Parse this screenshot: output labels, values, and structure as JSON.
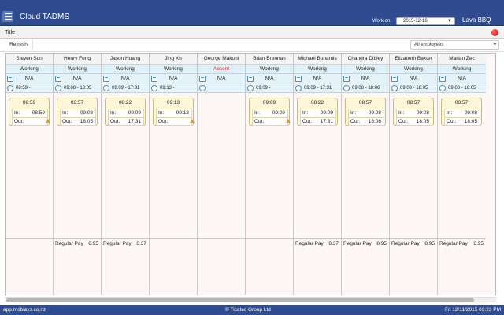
{
  "header": {
    "app_title": "Cloud TADMS",
    "work_on_label": "Work on:",
    "work_on_date": "2015-12-16",
    "company": "Lava BBQ"
  },
  "panel": {
    "title": "Title"
  },
  "toolbar": {
    "refresh_label": "Refresh",
    "employee_filter": "All employees"
  },
  "employees": [
    {
      "name": "Steven Sun",
      "status": "Working",
      "role": "N/A",
      "shift": "08:59 -",
      "card": {
        "time": "08:59",
        "in_label": "In:",
        "in": "08:59",
        "out_label": "Out:",
        "out": ""
      },
      "pay_label": "",
      "pay": ""
    },
    {
      "name": "Henry Feng",
      "status": "Working",
      "role": "N/A",
      "shift": "09:08 - 18:05",
      "card": {
        "time": "08:57",
        "in_label": "In:",
        "in": "09:08",
        "out_label": "Out:",
        "out": "18:05"
      },
      "pay_label": "Regular Pay",
      "pay": "8.95"
    },
    {
      "name": "Jason Huang",
      "status": "Working",
      "role": "N/A",
      "shift": "09:09 - 17:31",
      "card": {
        "time": "08:22",
        "in_label": "In:",
        "in": "09:09",
        "out_label": "Out:",
        "out": "17:31"
      },
      "pay_label": "Regular Pay",
      "pay": "8.37"
    },
    {
      "name": "Jing Xu",
      "status": "Working",
      "role": "N/A",
      "shift": "09:13 -",
      "card": {
        "time": "09:13",
        "in_label": "In:",
        "in": "09:13",
        "out_label": "Out:",
        "out": ""
      },
      "pay_label": "",
      "pay": ""
    },
    {
      "name": "George Makoni",
      "status": "Absent",
      "role": "N/A",
      "shift": "",
      "card": null,
      "pay_label": "",
      "pay": ""
    },
    {
      "name": "Brian Brennan",
      "status": "Working",
      "role": "N/A",
      "shift": "09:09 -",
      "card": {
        "time": "09:09",
        "in_label": "In:",
        "in": "09:09",
        "out_label": "Out:",
        "out": ""
      },
      "pay_label": "",
      "pay": ""
    },
    {
      "name": "Michael Bonamis",
      "status": "Working",
      "role": "N/A",
      "shift": "09:09 - 17:31",
      "card": {
        "time": "08:22",
        "in_label": "In:",
        "in": "09:09",
        "out_label": "Out:",
        "out": "17:31"
      },
      "pay_label": "Regular Pay",
      "pay": "8.37"
    },
    {
      "name": "Chandra Dibley",
      "status": "Working",
      "role": "N/A",
      "shift": "09:08 - 18:06",
      "card": {
        "time": "08:57",
        "in_label": "In:",
        "in": "09:08",
        "out_label": "Out:",
        "out": "18:06"
      },
      "pay_label": "Regular Pay",
      "pay": "8.95"
    },
    {
      "name": "Elizabeth Baxter",
      "status": "Working",
      "role": "N/A",
      "shift": "09:08 - 18:05",
      "card": {
        "time": "08:57",
        "in_label": "In:",
        "in": "09:08",
        "out_label": "Out:",
        "out": "18:05"
      },
      "pay_label": "Regular Pay",
      "pay": "8.95"
    },
    {
      "name": "Marian Zec",
      "status": "Working",
      "role": "N/A",
      "shift": "09:08 - 18:05",
      "card": {
        "time": "08:57",
        "in_label": "In:",
        "in": "09:08",
        "out_label": "Out:",
        "out": "18:05"
      },
      "pay_label": "Regular Pay",
      "pay": "8.95"
    }
  ],
  "footer": {
    "url": "app.mobiays.co.nz",
    "copyright": "© Ticatec Group Ltd",
    "datetime": "Fri 12/11/2015 03:23 PM"
  },
  "colors": {
    "brand": "#2e4c8f",
    "absent": "#dd2222",
    "card_bg": "#fdf6d8",
    "status_bg": "#dff0f8"
  },
  "icons": [
    "menu-icon",
    "calendar-icon",
    "clock-icon",
    "warning-icon",
    "close-icon"
  ]
}
